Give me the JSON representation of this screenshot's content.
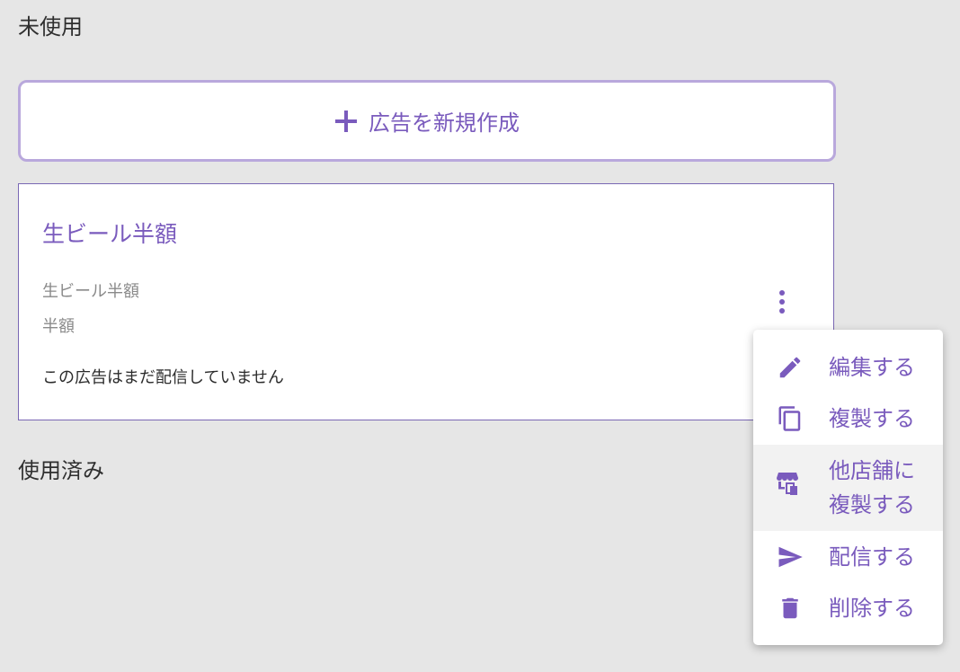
{
  "sections": {
    "unused_heading": "未使用",
    "used_heading": "使用済み"
  },
  "create_button": {
    "label": "広告を新規作成",
    "icon": "plus-icon"
  },
  "ad_card": {
    "title": "生ビール半額",
    "line1": "生ビール半額",
    "line2": "半額",
    "status": "この広告はまだ配信していません",
    "menu_icon": "more-vertical-icon"
  },
  "context_menu": {
    "items": [
      {
        "label": "編集する",
        "icon": "pencil-icon"
      },
      {
        "label": "複製する",
        "icon": "copy-icon"
      },
      {
        "label_line1": "他店舗に",
        "label_line2": "複製する",
        "icon": "store-copy-icon",
        "highlighted": true
      },
      {
        "label": "配信する",
        "icon": "send-icon"
      },
      {
        "label": "削除する",
        "icon": "trash-icon"
      }
    ]
  },
  "colors": {
    "accent": "#7a5bbd",
    "background": "#e6e6e6",
    "button_border": "#b9a8dc",
    "card_border": "#7a68b4",
    "muted_text": "#8a8a8a"
  }
}
